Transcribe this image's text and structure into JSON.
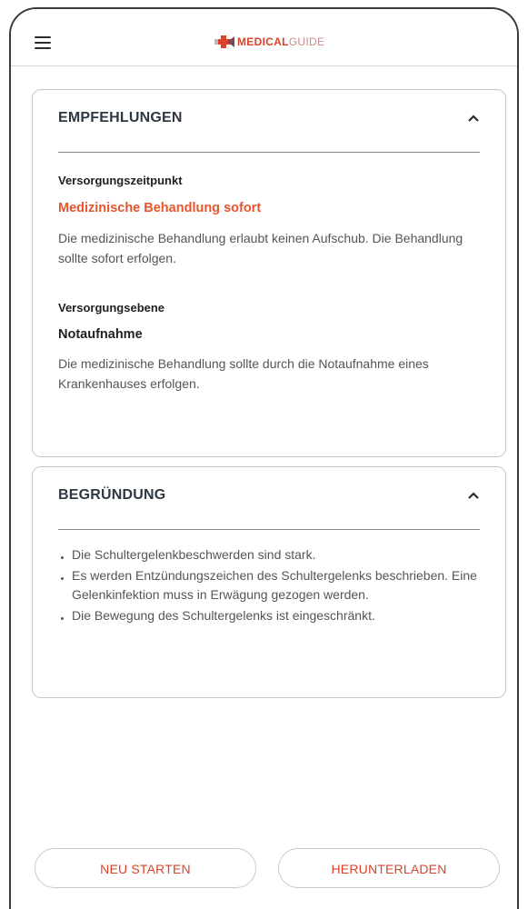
{
  "app": {
    "logo_text_bold": "MEDICAL",
    "logo_text_light": "GUIDE"
  },
  "recommendations": {
    "title": "EMPFEHLUNGEN",
    "timing_label": "Versorgungszeitpunkt",
    "timing_value": "Medizinische Behandlung sofort",
    "timing_text": "Die medizinische Behandlung erlaubt keinen Aufschub. Die Behandlung sollte sofort erfolgen.",
    "level_label": "Versorgungsebene",
    "level_value": "Notaufnahme",
    "level_text": "Die medizinische Behandlung sollte durch die Notaufnahme eines Krankenhauses erfolgen."
  },
  "reasoning": {
    "title": "BEGRÜNDUNG",
    "items": [
      "Die Schultergelenkbeschwerden sind stark.",
      "Es werden Entzündungszeichen des Schultergelenks beschrieben. Eine Gelenkinfektion muss in Erwägung gezogen werden.",
      "Die Bewegung des Schultergelenks ist eingeschränkt."
    ]
  },
  "actions": {
    "restart_label": "NEU STARTEN",
    "download_label": "HERUNTERLADEN"
  },
  "colors": {
    "accent": "#e8552c",
    "brand": "#d9432b",
    "heading": "#2d3844"
  }
}
